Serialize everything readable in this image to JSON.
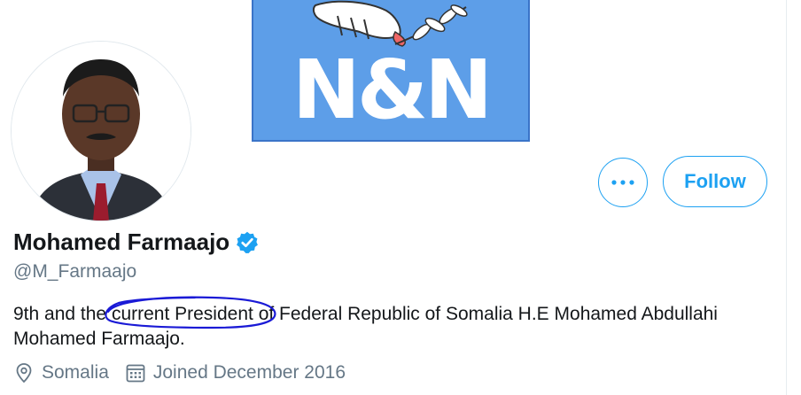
{
  "banner": {
    "logo_text": "N&N",
    "background": "#5d9ee8"
  },
  "actions": {
    "more_label": "•••",
    "follow_label": "Follow"
  },
  "profile": {
    "name": "Mohamed Farmaajo",
    "handle": "@M_Farmaajo",
    "verified": true,
    "bio_before": "9th and the ",
    "bio_highlight": "current President",
    "bio_after": " of Federal Republic of Somalia H.E Mohamed Abdullahi Mohamed Farmaajo.",
    "location": "Somalia",
    "joined": "Joined December 2016"
  },
  "icons": {
    "location": "location-pin-icon",
    "calendar": "calendar-icon",
    "verified": "verified-badge-icon",
    "more": "more-dots-icon"
  },
  "colors": {
    "accent": "#1da1f2",
    "secondary_text": "#657786",
    "annotation": "#1a1ad6"
  }
}
